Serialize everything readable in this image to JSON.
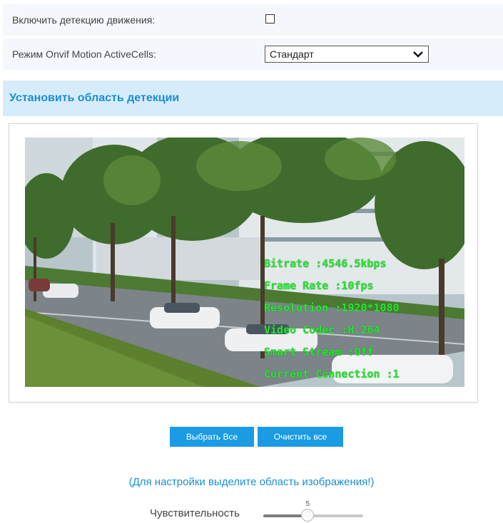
{
  "settings": {
    "motion_enable_label": "Включить детекцию движения:",
    "motion_enable_checked": false,
    "onvif_mode_label": "Режим Onvif Motion ActiveCells:",
    "onvif_mode_value": "Стандарт"
  },
  "detection_area": {
    "title": "Установить область детекции",
    "osd": {
      "line1": "Bitrate :4546.5kbps",
      "line2": "Frame Rate :10fps",
      "line3": "Resolution :1920*1080",
      "line4": "Video Codec :H.264",
      "line5": "Smart Stream :Off",
      "line6": "Current Connection :1"
    }
  },
  "buttons": {
    "select_all": "Выбрать Все",
    "clear_all": "Очистить все"
  },
  "hint": "(Для настройки выделите область изображения!)",
  "sensitivity": {
    "label": "Чувствительность",
    "value": "5",
    "min": 1,
    "max": 10
  },
  "colors": {
    "accent": "#1a9be4",
    "osd_text": "#2ae534",
    "section_bg": "#d7ecfa"
  },
  "icons": {
    "select_chevron": "chevron-down-icon"
  }
}
